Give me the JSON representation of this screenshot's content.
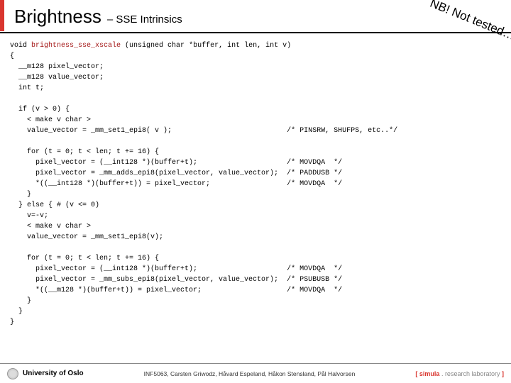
{
  "header": {
    "title": "Brightness",
    "subtitle": "– SSE Intrinsics"
  },
  "stamp": "NB! Not tested…",
  "code": {
    "sig_pre": "void ",
    "sig_fn": "brightness_sse_xscale",
    "sig_post": " (unsigned char *buffer, int len, int v)",
    "l01": "{",
    "l02": "  __m128 pixel_vector;",
    "l03": "  __m128 value_vector;",
    "l04": "  int t;",
    "l05": "",
    "l06": "  if (v > 0) {",
    "l07": "    < make v char >",
    "l08a": "    value_vector = _mm_set1_epi8( v );                           ",
    "l08b": "/* PINSRW, SHUFPS, etc..*/",
    "l09": "",
    "l10": "    for (t = 0; t < len; t += 16) {",
    "l11a": "      pixel_vector = (__int128 *)(buffer+t);                     ",
    "l11b": "/* MOVDQA  */",
    "l12a": "      pixel_vector = _mm_adds_epi8(pixel_vector, value_vector);  ",
    "l12b": "/* PADDUSB */",
    "l13a": "      *((__int128 *)(buffer+t)) = pixel_vector;                  ",
    "l13b": "/* MOVDQA  */",
    "l14": "    }",
    "l15": "  } else { # (v <= 0)",
    "l16": "    v=-v;",
    "l17": "    < make v char >",
    "l18": "    value_vector = _mm_set1_epi8(v);",
    "l19": "",
    "l20": "    for (t = 0; t < len; t += 16) {",
    "l21a": "      pixel_vector = (__int128 *)(buffer+t);                     ",
    "l21b": "/* MOVDQA  */",
    "l22a": "      pixel_vector = _mm_subs_epi8(pixel_vector, value_vector);  ",
    "l22b": "/* PSUBUSB */",
    "l23a": "      *((__m128 *)(buffer+t)) = pixel_vector;                    ",
    "l23b": "/* MOVDQA  */",
    "l24": "    }",
    "l25": "  }",
    "l26": "}"
  },
  "footer": {
    "uio": "University of Oslo",
    "course": "INF5063, Carsten Griwodz, Håvard Espeland, Håkon Stensland, Pål Halvorsen",
    "lab_bracket_open": "[ ",
    "lab_simula": "simula",
    "lab_rest": " . research laboratory ",
    "lab_bracket_close": "]"
  }
}
